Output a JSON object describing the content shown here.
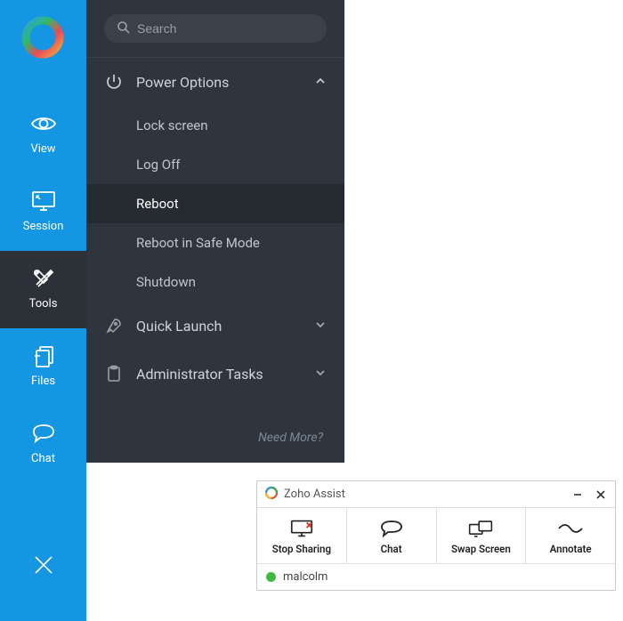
{
  "search": {
    "placeholder": "Search"
  },
  "sidebar": {
    "items": [
      {
        "label": "View"
      },
      {
        "label": "Session"
      },
      {
        "label": "Tools"
      },
      {
        "label": "Files"
      },
      {
        "label": "Chat"
      }
    ]
  },
  "panel": {
    "power": {
      "label": "Power Options",
      "items": [
        "Lock screen",
        "Log Off",
        "Reboot",
        "Reboot in Safe Mode",
        "Shutdown"
      ]
    },
    "quick_launch": {
      "label": "Quick Launch"
    },
    "admin": {
      "label": "Administrator Tasks"
    },
    "need_more": "Need More?"
  },
  "assist": {
    "title": "Zoho Assist",
    "toolbar": [
      {
        "label": "Stop Sharing"
      },
      {
        "label": "Chat"
      },
      {
        "label": "Swap Screen"
      },
      {
        "label": "Annotate"
      }
    ],
    "status_user": "malcolm"
  }
}
